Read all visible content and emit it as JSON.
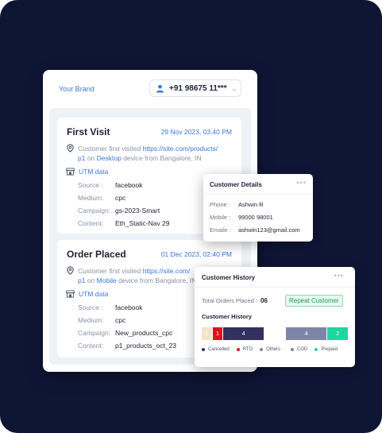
{
  "brand": {
    "label": "Your Brand"
  },
  "phone": {
    "number": "+91 98675 11***",
    "icon": "person-icon"
  },
  "visits": [
    {
      "title": "First Visit",
      "date": "29 Nov 2023, 03:40 PM",
      "loc_line1_prefix": "Customer first visited ",
      "loc_line1_link": "https://site.com/products/",
      "loc_line2_link": "p1",
      "loc_line2_mid": " on ",
      "device": "Desktop",
      "loc_line2_suffix": " device from Bangalore, IN",
      "utm_title": "UTM data",
      "utm": [
        {
          "key": "Source :",
          "value": "facebook"
        },
        {
          "key": "Medium:",
          "value": "cpc"
        },
        {
          "key": "Campaign:",
          "value": "gs-2023-Smart"
        },
        {
          "key": "Content:",
          "value": "Eth_Static-Nav 29"
        }
      ]
    },
    {
      "title": "Order Placed",
      "date": "01 Dec 2023, 02:40 PM",
      "loc_line1_prefix": "Customer first visited ",
      "loc_line1_link": "https://site.com/",
      "loc_line2_link": "p1",
      "loc_line2_mid": " on ",
      "device": "Mobile",
      "loc_line2_suffix": " device from Bangalore, IN",
      "utm_title": "UTM data",
      "utm": [
        {
          "key": "Source :",
          "value": "facebook"
        },
        {
          "key": "Medium:",
          "value": "cpc"
        },
        {
          "key": "Campaign:",
          "value": "New_products_cpc"
        },
        {
          "key": "Content:",
          "value": "p1_products_oct_23"
        }
      ]
    }
  ],
  "details": {
    "title": "Customer Details",
    "menu": "•••",
    "rows": [
      {
        "key": "Phone :",
        "value": "Ashwin R"
      },
      {
        "key": "Mobile :",
        "value": "99000 98001"
      },
      {
        "key": "Emaile :",
        "value": "ashwin123@gmail.com"
      }
    ]
  },
  "history": {
    "title": "Customer History",
    "menu": "•••",
    "total_label": "Total Orders Placed :",
    "total_value": "06",
    "badge": "Repeat Customer",
    "sub_title": "Customer History",
    "status_bar": [
      {
        "name": "Cancelled",
        "value": 1,
        "label": "1",
        "color": "#f2e4c6"
      },
      {
        "name": "RTO",
        "value": 1,
        "label": "1",
        "color": "#e0101e"
      },
      {
        "name": "Others",
        "value": 4,
        "label": "4",
        "color": "#33305f"
      }
    ],
    "payment_bar": [
      {
        "name": "COD",
        "value": 4,
        "label": "4",
        "color": "#7d85a8"
      },
      {
        "name": "Prepaid",
        "value": 2,
        "label": "2",
        "color": "#1ed6a0"
      }
    ],
    "status_legend": [
      {
        "name": "Cancelled",
        "color": "#33305f"
      },
      {
        "name": "RTO",
        "color": "#e0101e"
      },
      {
        "name": "Others",
        "color": "#7d85a8"
      }
    ],
    "payment_legend": [
      {
        "name": "COD",
        "color": "#7d85a8"
      },
      {
        "name": "Prepaid",
        "color": "#1ed6a0"
      }
    ]
  }
}
